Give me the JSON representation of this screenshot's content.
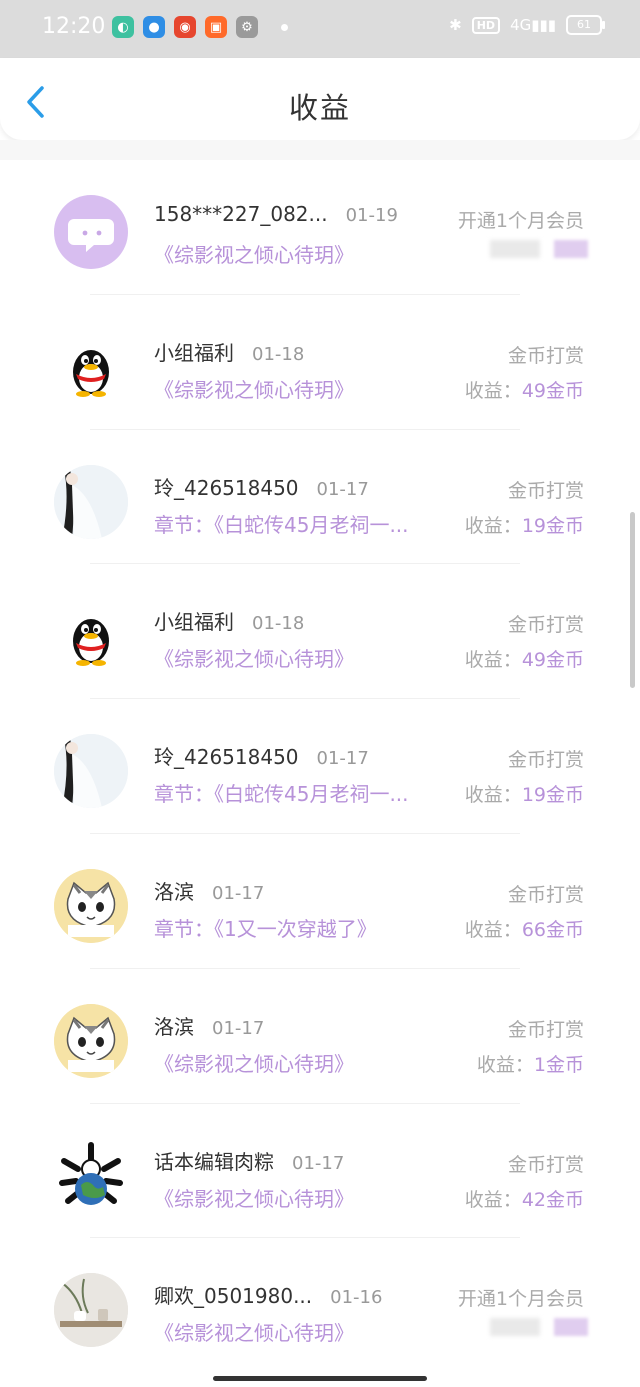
{
  "status_bar": {
    "time": "12:20",
    "apps": [
      "qq-browser-icon",
      "circle-app-icon",
      "weibo-icon",
      "bilibili-icon",
      "settings-gear-icon"
    ],
    "hd": "HD",
    "signal": "4G",
    "battery": "61"
  },
  "header": {
    "title": "收益",
    "back_icon": "chevron-left-icon"
  },
  "accent_color": "#b792d9",
  "rows": [
    {
      "avatar": "chat-bubble-avatar",
      "name": "158***227_082...",
      "date": "01-19",
      "work": "《综影视之倾心待玥》",
      "type": "开通1个月会员",
      "earn_label": "",
      "earn_value": ""
    },
    {
      "avatar": "qq-penguin-avatar",
      "name": "小组福利",
      "date": "01-18",
      "work": "《综影视之倾心待玥》",
      "type": "金币打赏",
      "earn_label": "收益：",
      "earn_value": "49金币"
    },
    {
      "avatar": "white-dress-avatar",
      "name": "玲_426518450",
      "date": "01-17",
      "work": "章节：《白蛇传45月老祠一...",
      "type": "金币打赏",
      "earn_label": "收益：",
      "earn_value": "19金币"
    },
    {
      "avatar": "qq-penguin-avatar",
      "name": "小组福利",
      "date": "01-18",
      "work": "《综影视之倾心待玥》",
      "type": "金币打赏",
      "earn_label": "收益：",
      "earn_value": "49金币"
    },
    {
      "avatar": "white-dress-avatar",
      "name": "玲_426518450",
      "date": "01-17",
      "work": "章节：《白蛇传45月老祠一...",
      "type": "金币打赏",
      "earn_label": "收益：",
      "earn_value": "19金币"
    },
    {
      "avatar": "cartoon-cat-avatar",
      "name": "洛滨",
      "date": "01-17",
      "work": "章节：《1又一次穿越了》",
      "type": "金币打赏",
      "earn_label": "收益：",
      "earn_value": "66金币"
    },
    {
      "avatar": "cartoon-cat-avatar",
      "name": "洛滨",
      "date": "01-17",
      "work": "《综影视之倾心待玥》",
      "type": "金币打赏",
      "earn_label": "收益：",
      "earn_value": "1金币"
    },
    {
      "avatar": "earth-bones-avatar",
      "name": "话本编辑肉粽",
      "date": "01-17",
      "work": "《综影视之倾心待玥》",
      "type": "金币打赏",
      "earn_label": "收益：",
      "earn_value": "42金币"
    },
    {
      "avatar": "tea-table-avatar",
      "name": "卿欢_0501980...",
      "date": "01-16",
      "work": "《综影视之倾心待玥》",
      "type": "开通1个月会员",
      "earn_label": "",
      "earn_value": ""
    }
  ]
}
